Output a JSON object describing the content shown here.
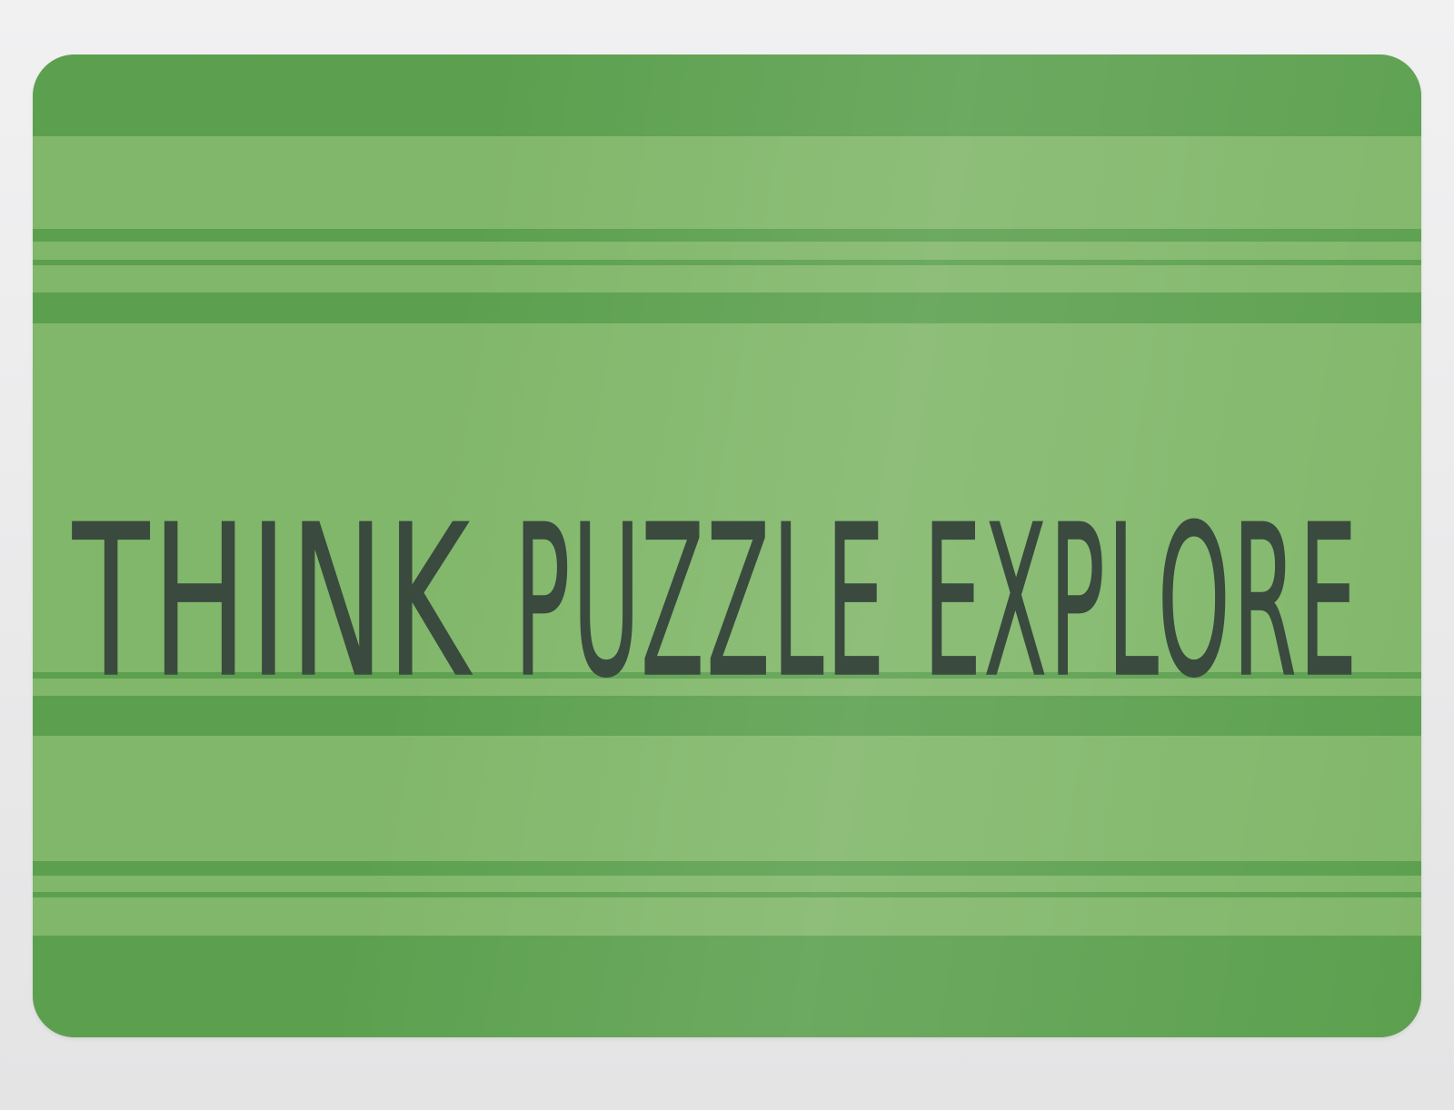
{
  "placemat": {
    "base_color": "#81b76a",
    "stripe_color": "#5ca04f",
    "text_color": "#3a4a3f",
    "words": [
      "THINK",
      "PUZZLE",
      "EXPLORE"
    ]
  }
}
